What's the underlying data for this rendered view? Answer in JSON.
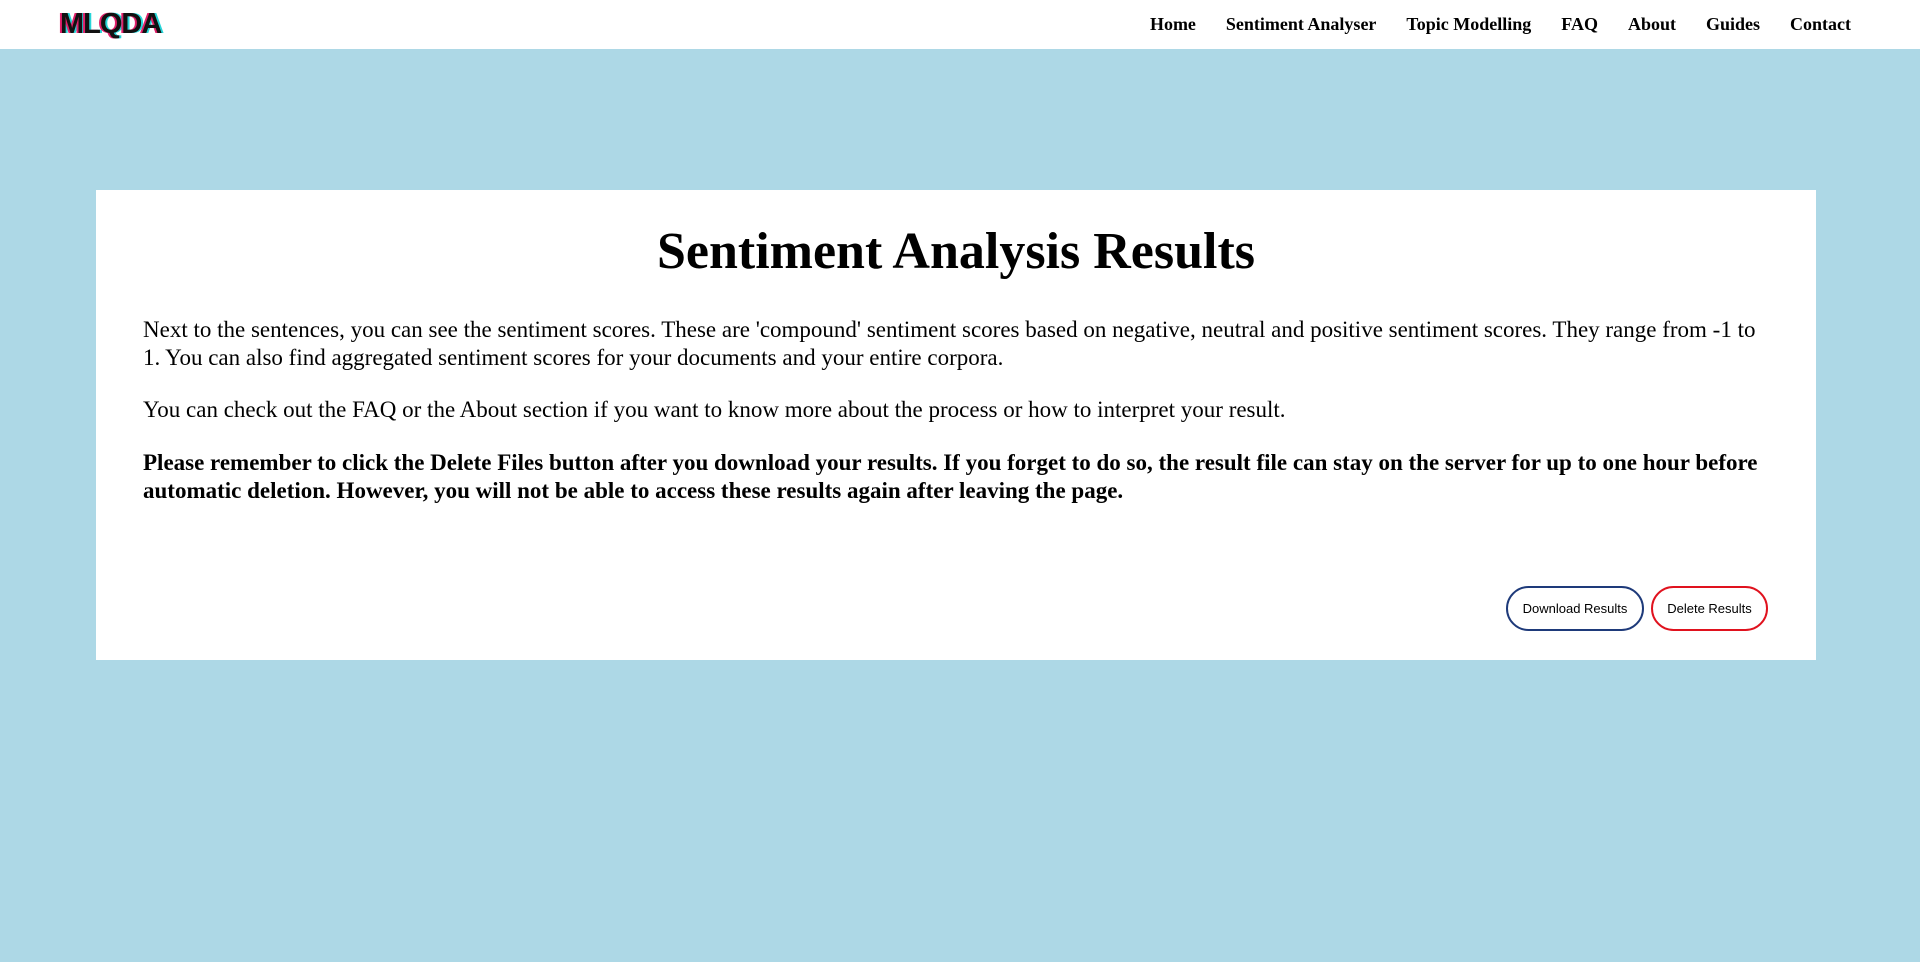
{
  "navbar": {
    "logo": "MLQDA",
    "links": [
      "Home",
      "Sentiment Analyser",
      "Topic Modelling",
      "FAQ",
      "About",
      "Guides",
      "Contact"
    ]
  },
  "card": {
    "title": "Sentiment Analysis Results",
    "paragraph1": "Next to the sentences, you can see the sentiment scores. These are 'compound' sentiment scores based on negative, neutral and positive sentiment scores. They range from -1 to 1. You can also find aggregated sentiment scores for your documents and your entire corpora.",
    "paragraph2": "You can check out the FAQ or the About section if you want to know more about the process or how to interpret your result.",
    "paragraph3": "Please remember to click the Delete Files button after you download your results. If you forget to do so, the result file can stay on the server for up to one hour before automatic deletion. However, you will not be able to access these results again after leaving the page.",
    "download_label": "Download Results",
    "delete_label": "Delete Results"
  },
  "colors": {
    "background": "#add8e6",
    "card": "#ffffff",
    "download_border": "#1e3a7a",
    "delete_border": "#e0121e"
  }
}
